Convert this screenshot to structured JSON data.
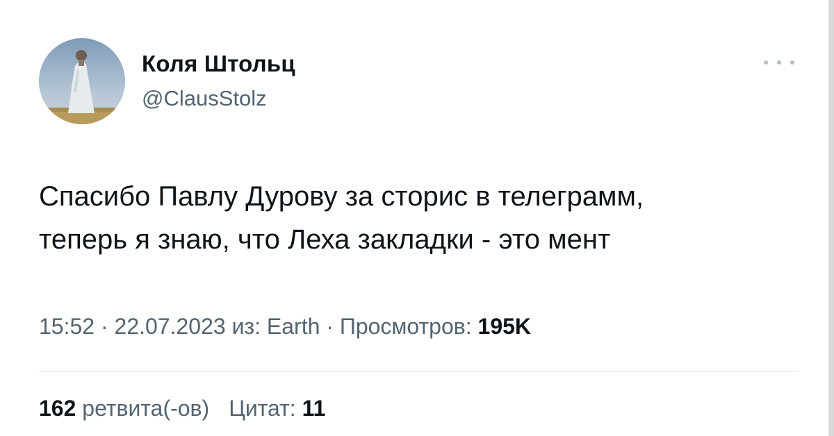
{
  "author": {
    "display_name": "Коля Штольц",
    "handle": "@ClausStolz"
  },
  "tweet": {
    "lines": [
      "Спасибо Павлу Дурову за сторис в телеграмм,",
      "теперь я знаю, что Леха закладки - это мент"
    ]
  },
  "meta": {
    "time": "15:52",
    "separator": " · ",
    "date": "22.07.2023",
    "source_prefix": " из: ",
    "source": "Earth",
    "views_label": "Просмотров: ",
    "views_count": "195K"
  },
  "stats": {
    "retweets_count": "162",
    "retweets_label": " ретвита(-ов)",
    "quotes_label": "Цитат: ",
    "quotes_count": "11"
  },
  "icons": {
    "more": "more-horizontal-icon"
  }
}
